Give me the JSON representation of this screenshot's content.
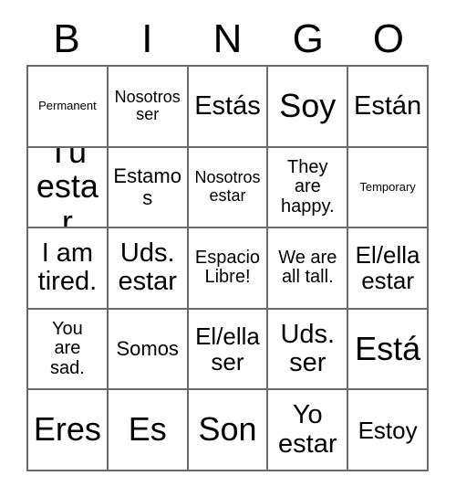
{
  "card": {
    "header_letters": [
      "B",
      "I",
      "N",
      "G",
      "O"
    ],
    "columns": 5,
    "rows": 5,
    "border_color": "#6b6b6b",
    "background_color": "#ffffff",
    "text_color": "#000000",
    "free_space_label": "Espacio Libre!",
    "cells": [
      [
        {
          "text": "Permanent",
          "size": "fs-xs"
        },
        {
          "text": "Nosotros\nser",
          "size": "fs-s"
        },
        {
          "text": "Estás",
          "size": "fs-xl"
        },
        {
          "text": "Soy",
          "size": "fs-xxl"
        },
        {
          "text": "Están",
          "size": "fs-xl"
        }
      ],
      [
        {
          "text": "Tú\nestar",
          "size": "fs-xxl"
        },
        {
          "text": "Estamos",
          "size": "fs-ml"
        },
        {
          "text": "Nosotros\nestar",
          "size": "fs-s"
        },
        {
          "text": "They\nare\nhappy.",
          "size": "fs-m"
        },
        {
          "text": "Temporary",
          "size": "fs-xs"
        }
      ],
      [
        {
          "text": "I am\ntired.",
          "size": "fs-xl"
        },
        {
          "text": "Uds.\nestar",
          "size": "fs-xl"
        },
        {
          "text": "Espacio\nLibre!",
          "size": "fs-m"
        },
        {
          "text": "We are\nall tall.",
          "size": "fs-m"
        },
        {
          "text": "El/ella\nestar",
          "size": "fs-l"
        }
      ],
      [
        {
          "text": "You\nare\nsad.",
          "size": "fs-m"
        },
        {
          "text": "Somos",
          "size": "fs-ml"
        },
        {
          "text": "El/ella\nser",
          "size": "fs-l"
        },
        {
          "text": "Uds.\nser",
          "size": "fs-xl"
        },
        {
          "text": "Está",
          "size": "fs-xxl"
        }
      ],
      [
        {
          "text": "Eres",
          "size": "fs-xxl"
        },
        {
          "text": "Es",
          "size": "fs-xxl"
        },
        {
          "text": "Son",
          "size": "fs-xxl"
        },
        {
          "text": "Yo\nestar",
          "size": "fs-xl"
        },
        {
          "text": "Estoy",
          "size": "fs-l"
        }
      ]
    ]
  }
}
